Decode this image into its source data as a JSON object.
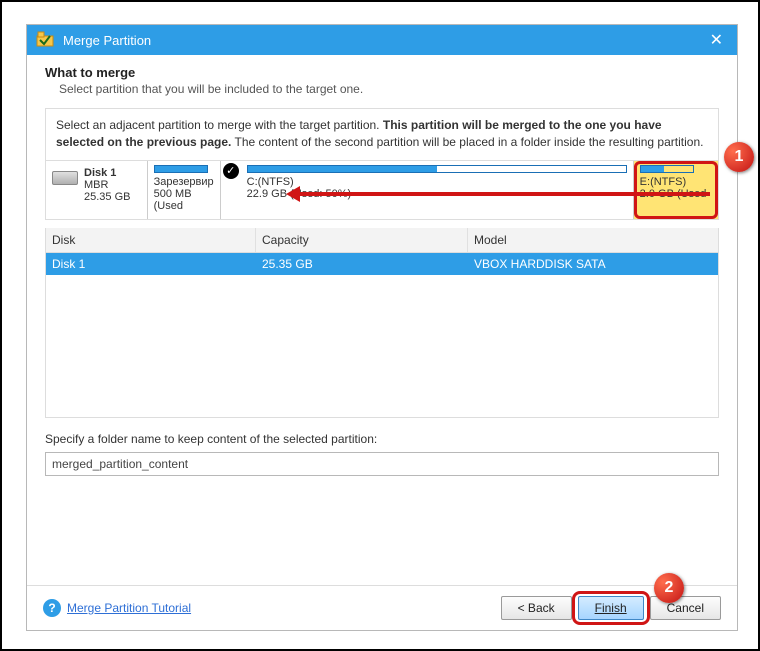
{
  "titlebar": {
    "title": "Merge Partition"
  },
  "heading": "What to merge",
  "subheading": "Select partition that you will be included to the target one.",
  "instruction_pre": "Select an adjacent partition to merge with the target partition. ",
  "instruction_bold": "This partition will be merged to the one you have selected on the previous page.",
  "instruction_post": " The content of the second partition will be placed in a folder inside the resulting partition.",
  "disk": {
    "name": "Disk 1",
    "type": "MBR",
    "size": "25.35 GB"
  },
  "partitions": [
    {
      "label": "Зарезервир",
      "sub": "500 MB (Used"
    },
    {
      "label": "C:(NTFS)",
      "sub": "22.9 GB (Used: 50%)"
    },
    {
      "label": "E:(NTFS)",
      "sub": "2.0 GB (Used"
    }
  ],
  "table": {
    "headers": [
      "Disk",
      "Capacity",
      "Model"
    ],
    "row": {
      "disk": "Disk 1",
      "capacity": "25.35 GB",
      "model": "VBOX HARDDISK SATA"
    }
  },
  "folder_label": "Specify a folder name to keep content of the selected partition:",
  "folder_value": "merged_partition_content",
  "tutorial": "Merge Partition Tutorial",
  "buttons": {
    "back": "< Back",
    "finish": "Finish",
    "cancel": "Cancel"
  },
  "markers": {
    "m1": "1",
    "m2": "2"
  }
}
